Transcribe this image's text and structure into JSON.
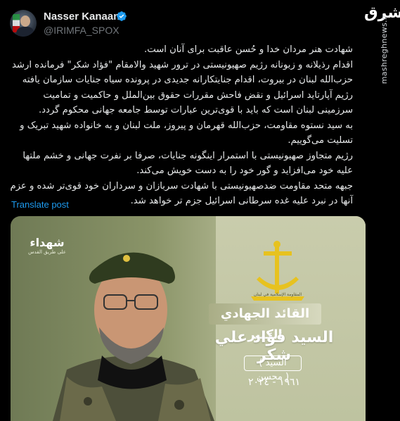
{
  "author": {
    "name": "Nasser Kanaani",
    "handle": "@IRIMFA_SPOX"
  },
  "watermark": {
    "brand": "مشرق",
    "url": "mashreghnews.ir"
  },
  "post": {
    "paragraphs": [
      "شهادت هنر مردان خدا و حُسن عاقبت برای آنان است.",
      "اقدام رذیلانه و زبونانه رژیم صهیونیستی در ترور شهید والامقام \"فؤاد شکر\" فرمانده ارشد حزب‌الله لبنان در بیروت، اقدام جنایتکارانه جدیدی در پرونده سیاه جنایات سازمان یافته رژیم آپارتاید اسرائیل و نقض فاحش مقررات حقوق بین‌الملل و حاکمیت و تمامیت سرزمینی لبنان است که باید با قوی‌ترین عبارات توسط جامعه جهانی محکوم گردد.",
      "به سید نستوه مقاومت، حزب‌الله قهرمان و پیروز، ملت لبنان و به خانواده شهید تبریک و تسلیت می‌گوییم.",
      "رژیم متجاوز صهیونیستی با استمرار اینگونه جنایات، صرفا بر نفرت جهانی و خشم ملتها علیه خود می‌افزاید و گور خود را به دست خویش می‌کند.",
      "جبهه متحد مقاومت ضدصهیونیستی با شهادت سربازان و سرداران خود قوی‌تر شده و عزم آنها در نبرد علیه غده سرطانی اسرائیل جزم تر خواهد شد."
    ],
    "translate_label": "Translate post"
  },
  "media": {
    "brand_title": "شهداء",
    "brand_subtitle": "على طريق القدس",
    "emblem_caption": "المقاومة الإسلامية في لبنان",
    "title_top": "القائد الجهادي الكبير",
    "title_main": "السيد فؤاد علي شكر",
    "title_sub": "( السيد محسن )",
    "years": "١٩٦١ - ٢٠٢٤"
  },
  "icons": {
    "verified": "verified-badge-icon",
    "avatar": "avatar"
  },
  "colors": {
    "background": "#000000",
    "text": "#e7e9ea",
    "muted": "#71767b",
    "link": "#1d9bf0",
    "verified": "#1d9bf0"
  }
}
